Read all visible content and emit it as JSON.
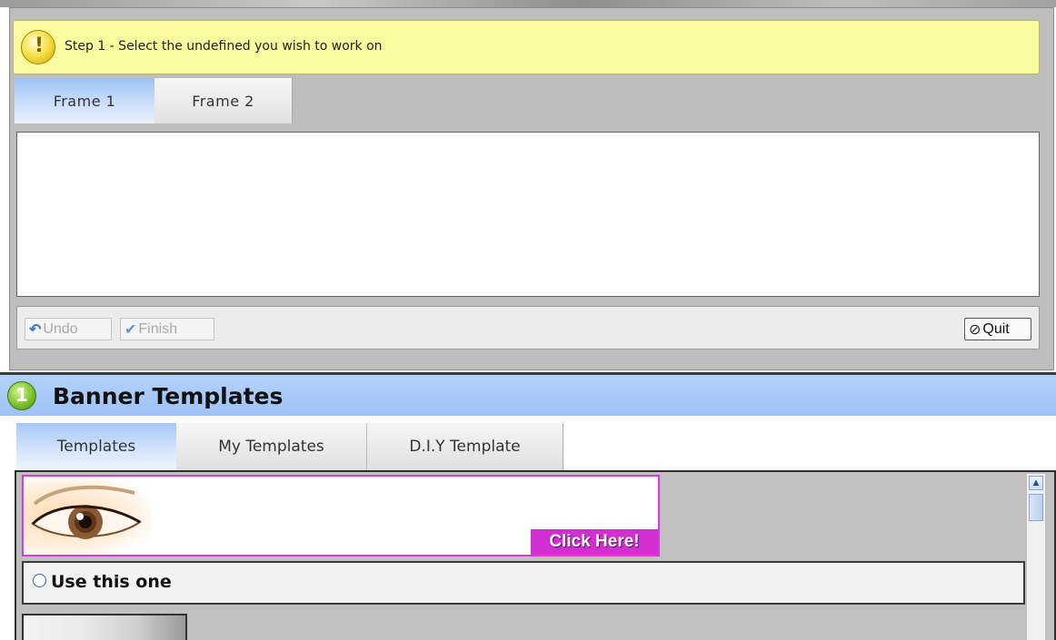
{
  "notice": {
    "text": "Step 1 - Select the undefined you wish to work on",
    "icon": "warning-icon"
  },
  "frame_tabs": [
    {
      "label": "Frame 1",
      "active": true
    },
    {
      "label": "Frame 2",
      "active": false
    }
  ],
  "toolbar": {
    "undo_label": "Undo",
    "finish_label": "Finish",
    "quit_label": "Quit"
  },
  "section": {
    "step": "1",
    "title": "Banner Templates"
  },
  "template_tabs": [
    {
      "label": "Templates",
      "active": true
    },
    {
      "label": "My Templates",
      "active": false
    },
    {
      "label": "D.I.Y Template",
      "active": false
    }
  ],
  "templates": [
    {
      "banner_button": "Click Here!",
      "choose_label": "Use this one",
      "selected": false
    }
  ],
  "colors": {
    "notice_bg": "#fafa9e",
    "active_tab": "#9cc2f4",
    "section_header": "#b3d1fb",
    "banner_accent": "#d12fd1"
  }
}
